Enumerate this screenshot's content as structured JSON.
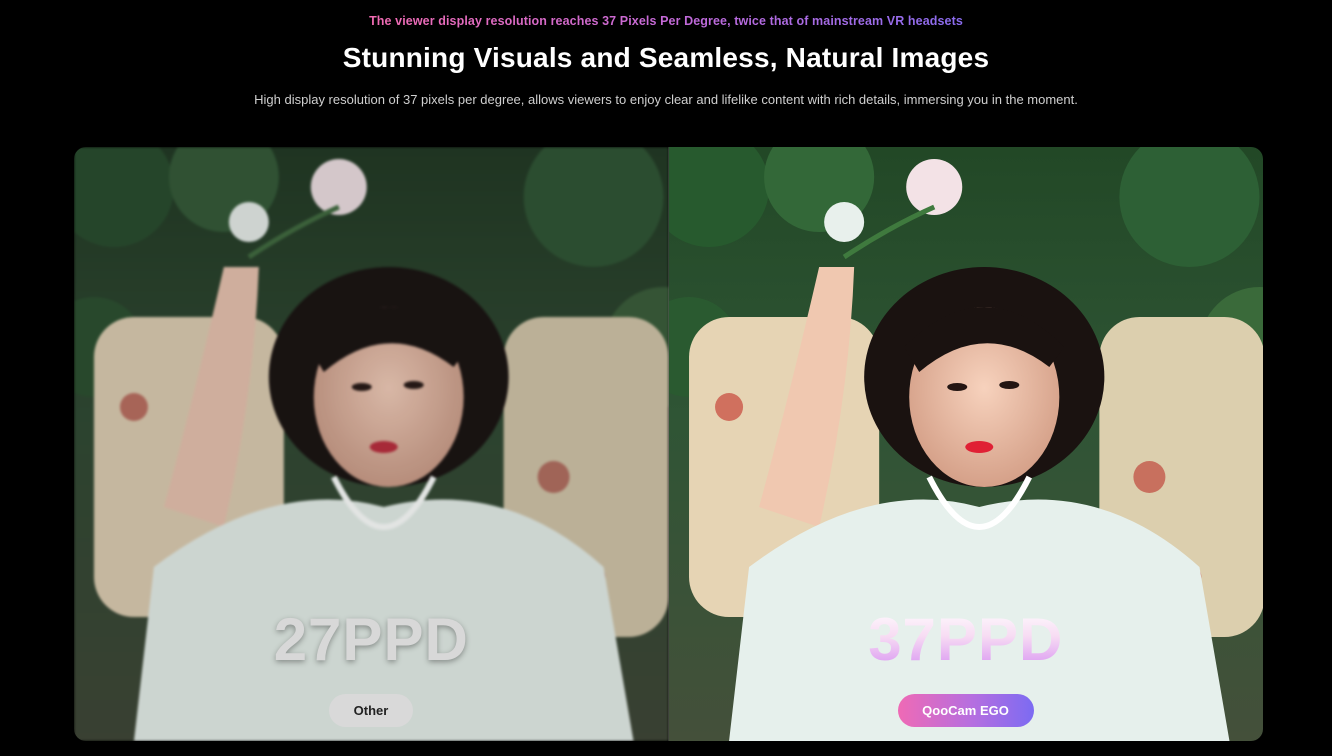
{
  "header": {
    "eyebrow": "The viewer display resolution reaches 37 Pixels Per Degree, twice that of mainstream VR headsets",
    "title": "Stunning Visuals and Seamless, Natural Images",
    "subtitle": "High display resolution of 37 pixels per degree, allows viewers to enjoy clear and lifelike content with rich details, immersing you in the moment."
  },
  "comparison": {
    "left": {
      "ppd_label": "27PPD",
      "badge_label": "Other"
    },
    "right": {
      "ppd_label": "37PPD",
      "badge_label": "QooCam EGO"
    }
  },
  "colors": {
    "background": "#000000",
    "accent_pink": "#ef6ab5",
    "accent_purple": "#7c6bf2",
    "badge_other": "#d9d9d9"
  },
  "images": {
    "left": "portrait-photo-low-resolution",
    "right": "portrait-photo-high-resolution"
  }
}
